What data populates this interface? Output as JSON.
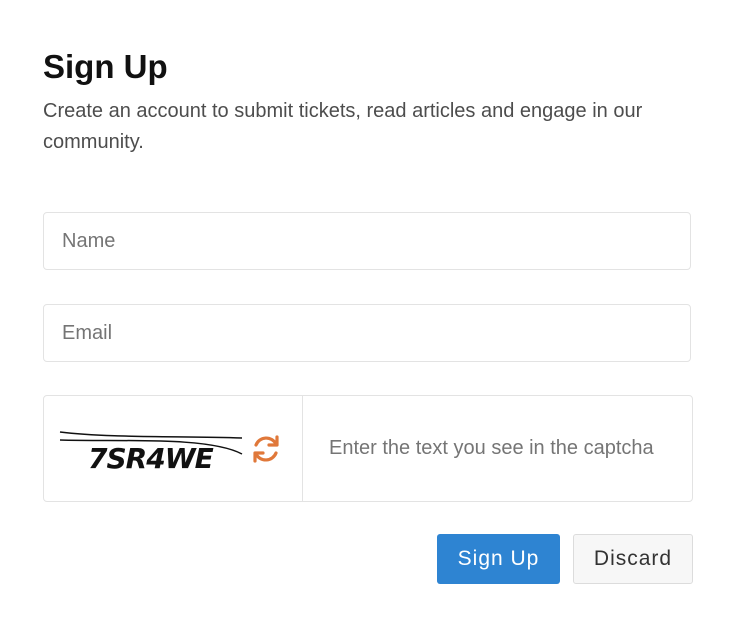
{
  "form": {
    "title": "Sign Up",
    "subtitle": "Create an account to submit tickets, read articles and engage in our community.",
    "name_placeholder": "Name",
    "email_placeholder": "Email",
    "captcha": {
      "image_text": "7SR4WE",
      "refresh_icon": "refresh-icon",
      "input_placeholder": "Enter the text you see in the captcha"
    },
    "submit_label": "Sign Up",
    "discard_label": "Discard"
  },
  "colors": {
    "primary_button": "#2e84d2",
    "refresh_icon": "#e0783a"
  }
}
